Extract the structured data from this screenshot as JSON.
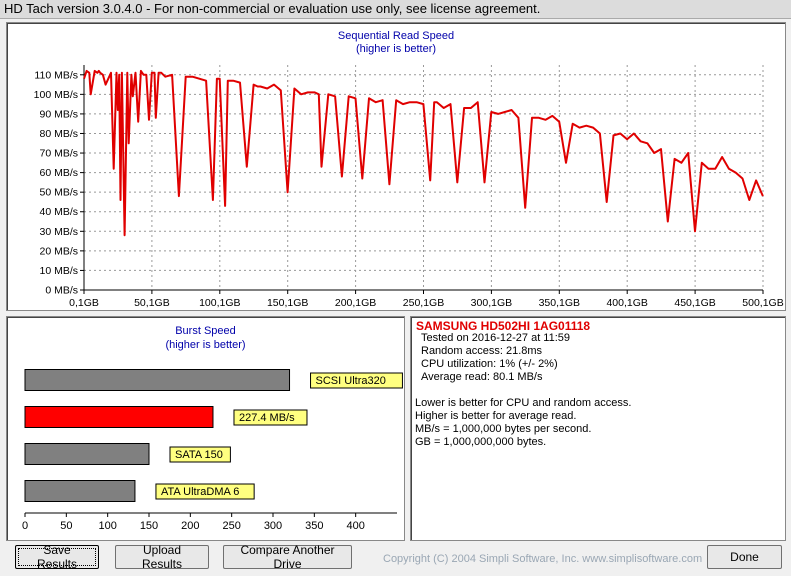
{
  "window": {
    "title": "HD Tach version 3.0.4.0  - For non-commercial or evaluation use only, see license agreement."
  },
  "sequential": {
    "title": "Sequential Read Speed",
    "subtitle": "(higher is better)"
  },
  "burst": {
    "title": "Burst Speed",
    "subtitle": "(higher is better)"
  },
  "info": {
    "drive": "SAMSUNG HD502HI 1AG01118",
    "tested": "Tested on 2016-12-27 at 11:59",
    "random_access": "Random access: 21.8ms",
    "cpu": "CPU utilization: 1% (+/- 2%)",
    "average": "Average read: 80.1 MB/s",
    "notes": [
      "Lower is better for CPU and random access.",
      "Higher is better for average read.",
      "MB/s = 1,000,000 bytes per second.",
      "GB = 1,000,000,000 bytes."
    ]
  },
  "buttons": {
    "save": "Save Results",
    "upload": "Upload Results",
    "compare": "Compare Another Drive",
    "done": "Done"
  },
  "copyright": "Copyright (C) 2004 Simpli Software, Inc. www.simplisoftware.com",
  "colors": {
    "read_line": "#e00000",
    "burst_bar": "#ff0000",
    "ref_bar": "#808080",
    "label_bg": "#ffff80",
    "title_blue": "#0000aa"
  },
  "chart_data": [
    {
      "type": "line",
      "title": "Sequential Read Speed",
      "subtitle": "(higher is better)",
      "x_ticks": [
        "0,1GB",
        "50,1GB",
        "100,1GB",
        "150,1GB",
        "200,1GB",
        "250,1GB",
        "300,1GB",
        "350,1GB",
        "400,1GB",
        "450,1GB",
        "500,1GB"
      ],
      "y_ticks": [
        "0 MB/s",
        "10 MB/s",
        "20 MB/s",
        "30 MB/s",
        "40 MB/s",
        "50 MB/s",
        "60 MB/s",
        "70 MB/s",
        "80 MB/s",
        "90 MB/s",
        "100 MB/s",
        "110 MB/s"
      ],
      "xlim": [
        0.1,
        500.1
      ],
      "ylim": [
        0,
        115
      ],
      "grid": true,
      "series": [
        {
          "x": [
            0.1,
            2,
            4,
            5,
            8,
            10,
            11,
            12,
            14,
            16,
            18,
            20,
            22,
            24,
            25,
            26,
            27,
            28,
            30,
            32,
            33,
            35,
            36,
            38,
            40,
            42,
            44,
            46,
            48,
            50,
            52,
            53,
            55,
            57,
            60,
            65,
            70,
            75,
            78,
            80,
            85,
            90,
            95,
            98,
            100,
            104,
            106,
            110,
            115,
            120,
            125,
            128,
            130,
            135,
            140,
            145,
            150,
            155,
            160,
            165,
            170,
            173,
            175,
            180,
            185,
            190,
            195,
            200,
            205,
            210,
            215,
            220,
            225,
            230,
            235,
            240,
            245,
            250,
            255,
            258,
            260,
            265,
            270,
            275,
            280,
            285,
            290,
            295,
            300,
            305,
            310,
            315,
            320,
            325,
            330,
            335,
            340,
            345,
            350,
            355,
            360,
            365,
            370,
            375,
            380,
            385,
            390,
            395,
            400,
            405,
            410,
            415,
            420,
            425,
            430,
            435,
            440,
            445,
            450,
            455,
            460,
            465,
            470,
            475,
            480,
            485,
            490,
            495,
            500
          ],
          "y": [
            108,
            112,
            111,
            100,
            112,
            111,
            112,
            111,
            110,
            105,
            108,
            111,
            62,
            111,
            92,
            110,
            46,
            111,
            28,
            111,
            75,
            110,
            99,
            111,
            86,
            112,
            110,
            110,
            87,
            111,
            111,
            88,
            111,
            111,
            109,
            110,
            48,
            109,
            109,
            109,
            108,
            107,
            46,
            108,
            108,
            43,
            107,
            107,
            106,
            63,
            105,
            104,
            104,
            103,
            105,
            102,
            50,
            103,
            100,
            101,
            101,
            100,
            63,
            100,
            99,
            58,
            99,
            98,
            57,
            98,
            96,
            97,
            54,
            97,
            95,
            96,
            96,
            95,
            56,
            96,
            96,
            93,
            95,
            55,
            93,
            93,
            96,
            55,
            91,
            90,
            91,
            92,
            88,
            42,
            88,
            88,
            87,
            89,
            86,
            65,
            85,
            83,
            84,
            83,
            80,
            45,
            79,
            80,
            77,
            80,
            76,
            75,
            70,
            72,
            35,
            67,
            65,
            70,
            30,
            65,
            62,
            62,
            68,
            62,
            60,
            57,
            46,
            56,
            48
          ]
        }
      ]
    },
    {
      "type": "bar",
      "title": "Burst Speed",
      "subtitle": "(higher is better)",
      "categories": [
        "SCSI Ultra320",
        "227.4 MB/s",
        "SATA 150",
        "ATA UltraDMA 6"
      ],
      "values": [
        320,
        227.4,
        150,
        133
      ],
      "xlim": [
        0,
        450
      ],
      "x_ticks": [
        "0",
        "50",
        "100",
        "150",
        "200",
        "250",
        "300",
        "350",
        "400"
      ],
      "grid": false
    }
  ]
}
